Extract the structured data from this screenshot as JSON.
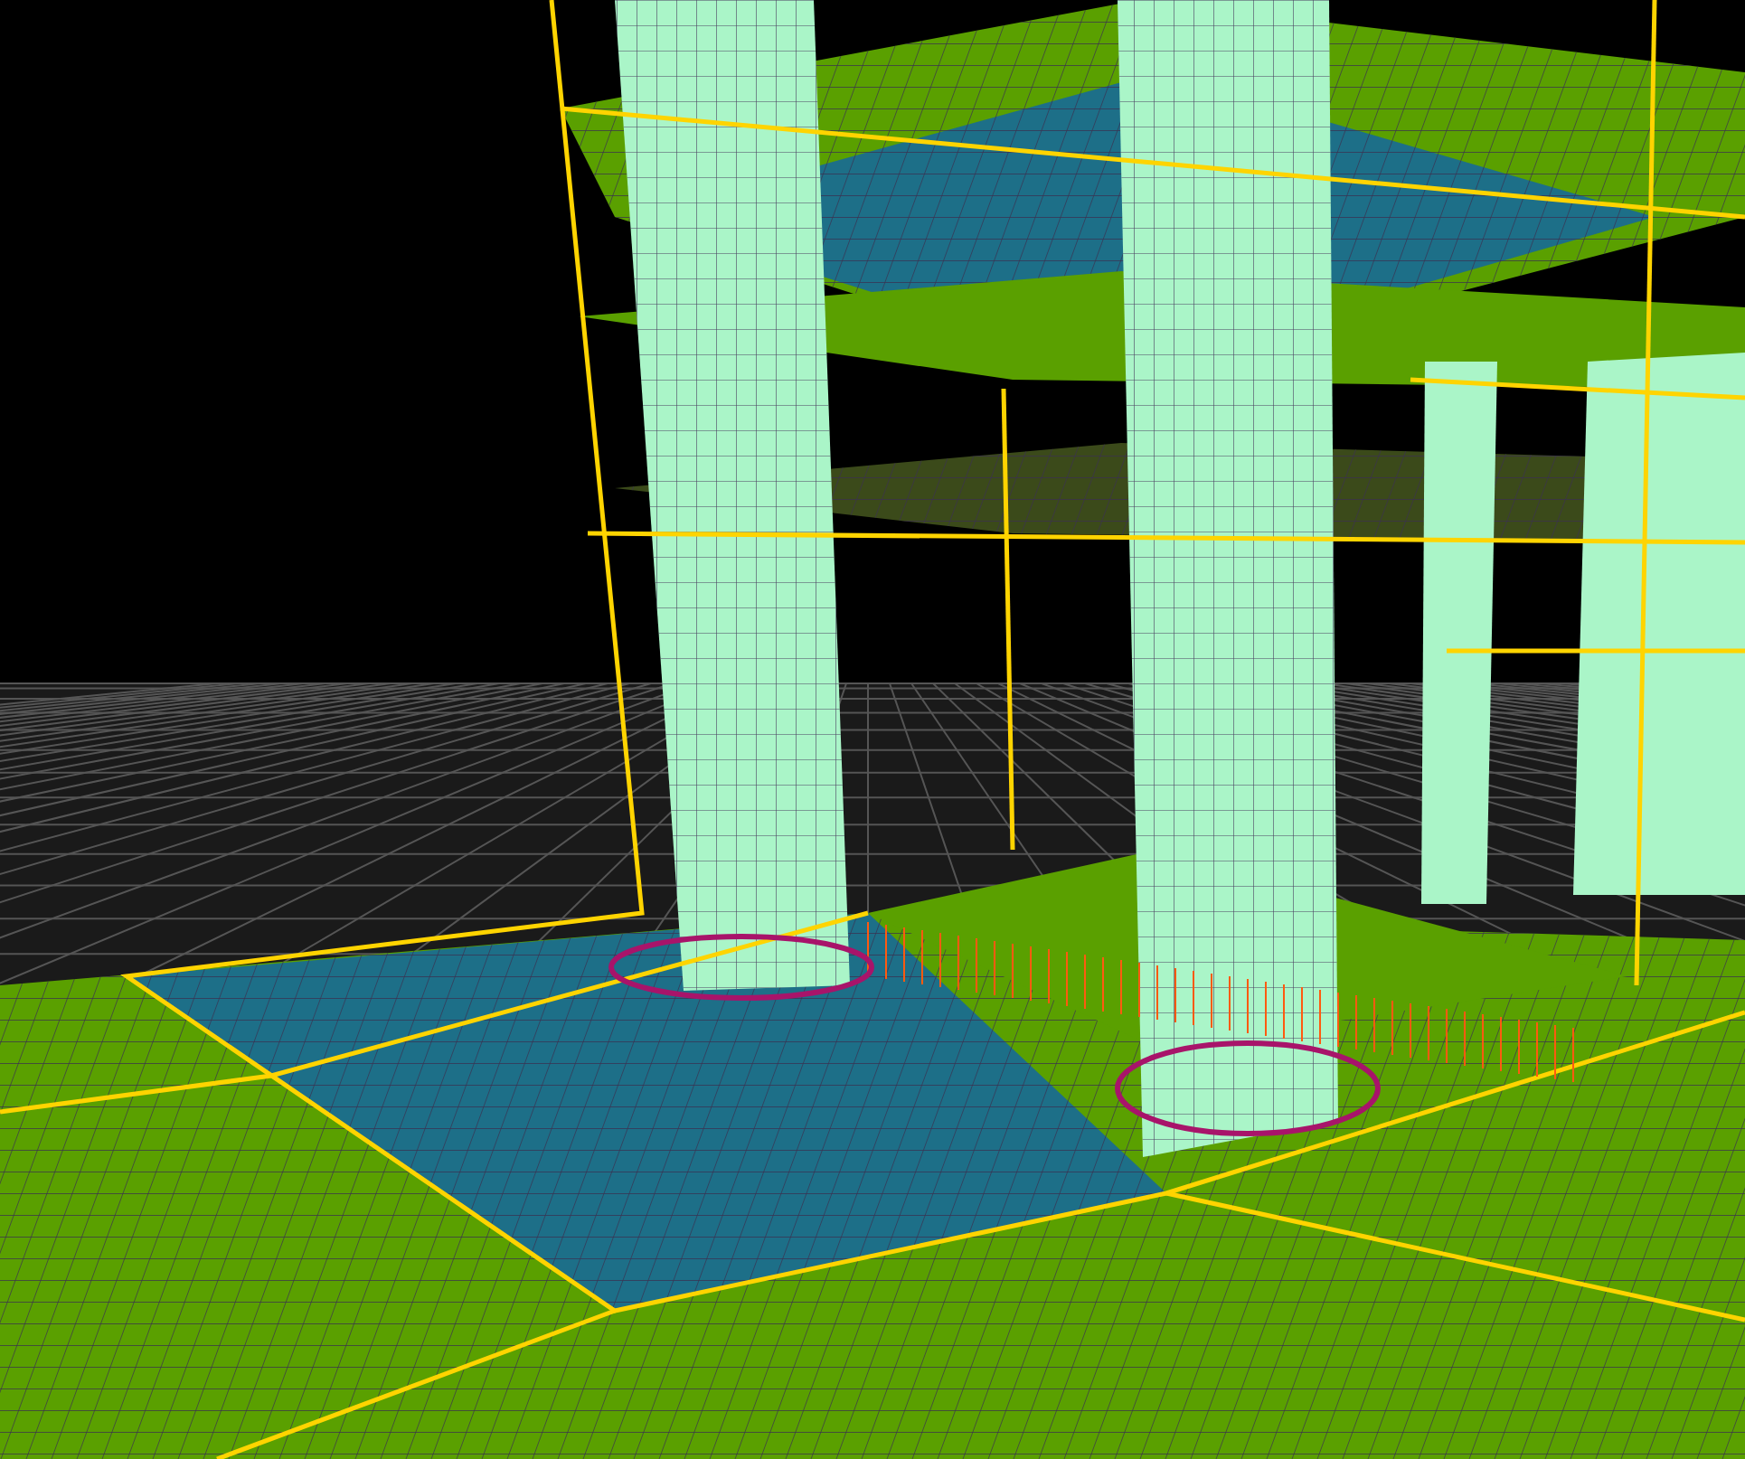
{
  "viewport": {
    "kind": "mesh-3d"
  }
}
